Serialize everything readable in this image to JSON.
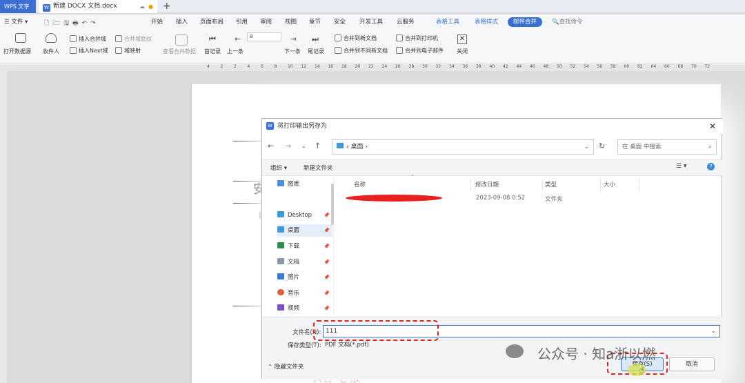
{
  "titlebar": {
    "app_tab": "WPS 文字",
    "doc_tab": "新建 DOCX 文档.docx",
    "new_tab": "+"
  },
  "menubar": {
    "file": "文件",
    "items": [
      "开始",
      "插入",
      "页面布局",
      "引用",
      "审阅",
      "视图",
      "章节",
      "安全",
      "开发工具",
      "云服务",
      "表格工具",
      "表格样式",
      "邮件合并"
    ],
    "search": "查找命令"
  },
  "ribbon": {
    "open_source": "打开数据源",
    "recipients": "收件人",
    "insert_merge_field": "插入合并域",
    "merge_field_mark": "合并域底纹",
    "insert_next": "插入Next域",
    "field_map": "域映射",
    "view_merge": "查看合并数据",
    "first": "首记录",
    "prev": "上一条",
    "record_no": "8",
    "next": "下一条",
    "last": "尾记录",
    "merge_new_doc": "合并到新文档",
    "merge_diff_doc": "合并到不同新文档",
    "merge_printer": "合并到打印机",
    "merge_email": "合并到电子邮件",
    "close": "关闭"
  },
  "ruler": [
    "4",
    "2",
    "2",
    "4",
    "6",
    "8",
    "10",
    "12",
    "14",
    "16",
    "18",
    "20",
    "22",
    "24",
    "26",
    "28",
    "30",
    "32",
    "34",
    "36",
    "38",
    "40",
    "42",
    "44",
    "46",
    "48",
    "50",
    "52",
    "54",
    "56",
    "58",
    "60",
    "62",
    "64",
    "66",
    "68",
    "70",
    "72"
  ],
  "document": {
    "fragment1": "安",
    "fragment2": "I",
    "fragment3": "人台 宅 放"
  },
  "dialog": {
    "title": "将打印输出另存为",
    "address": "桌面",
    "search_placeholder": "在 桌面 中搜索",
    "organize": "组织 ▾",
    "new_folder": "新建文件夹",
    "nav_items": [
      {
        "label": "图库",
        "pin": ""
      },
      {
        "label": "Desktop",
        "pin": "📌"
      },
      {
        "label": "桌面",
        "pin": "📌"
      },
      {
        "label": "下载",
        "pin": "📌"
      },
      {
        "label": "文档",
        "pin": "📌"
      },
      {
        "label": "图片",
        "pin": "📌"
      },
      {
        "label": "音乐",
        "pin": "📌"
      },
      {
        "label": "视频",
        "pin": "📌"
      }
    ],
    "columns": {
      "name": "名称",
      "date": "修改日期",
      "type": "类型",
      "size": "大小"
    },
    "row": {
      "date": "2023-09-08 0:52",
      "type": "文件夹"
    },
    "filename_label": "文件名(N):",
    "filename_value": "111",
    "filetype_label": "保存类型(T):",
    "filetype_value": "PDF 文档(*.pdf)",
    "hide_folders": "隐藏文件夹",
    "save": "保存(S)",
    "cancel": "取消"
  },
  "watermark": "公众号 · 知a浙以燃",
  "colors": {
    "accent": "#3b6fd1",
    "redline": "#e23b3b",
    "highlight": "#d4e34a"
  }
}
